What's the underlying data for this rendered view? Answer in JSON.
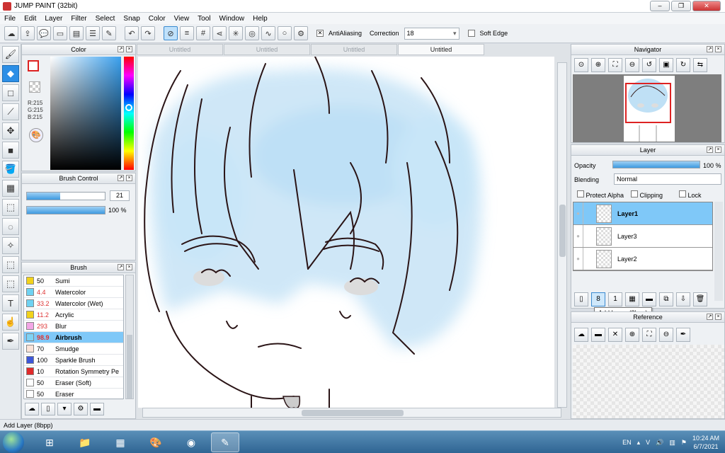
{
  "window": {
    "title": "JUMP PAINT (32bit)"
  },
  "menu": [
    "File",
    "Edit",
    "Layer",
    "Filter",
    "Select",
    "Snap",
    "Color",
    "View",
    "Tool",
    "Window",
    "Help"
  ],
  "toolbar": {
    "antialias_label": "AntiAliasing",
    "correction_label": "Correction",
    "correction_value": "18",
    "softedge_label": "Soft Edge"
  },
  "color_panel": {
    "title": "Color",
    "r": "R:215",
    "g": "G:215",
    "b": "B:215"
  },
  "brush_control": {
    "title": "Brush Control",
    "size": "21",
    "opacity": "100 %",
    "size_fraction": 0.43,
    "opacity_fraction": 1.0
  },
  "brush_panel": {
    "title": "Brush",
    "items": [
      {
        "size": "50",
        "name": "Sumi",
        "color": "#f2d21b"
      },
      {
        "size": "4.4",
        "name": "Watercolor",
        "color": "#6fd2f2"
      },
      {
        "size": "33.2",
        "name": "Watercolor (Wet)",
        "color": "#6fd2f2"
      },
      {
        "size": "11.2",
        "name": "Acrylic",
        "color": "#f2d21b"
      },
      {
        "size": "293",
        "name": "Blur",
        "color": "#f3a6e6"
      },
      {
        "size": "98.9",
        "name": "Airbrush",
        "color": "#7fd3f5"
      },
      {
        "size": "70",
        "name": "Smudge",
        "color": "#fbe3d8"
      },
      {
        "size": "100",
        "name": "Sparkle Brush",
        "color": "#3d57d8"
      },
      {
        "size": "10",
        "name": "Rotation Symmetry Pe",
        "color": "#e02a2a"
      },
      {
        "size": "50",
        "name": "Eraser (Soft)",
        "color": "#ffffff"
      },
      {
        "size": "50",
        "name": "Eraser",
        "color": "#ffffff"
      }
    ]
  },
  "tabs": [
    "Untitled",
    "Untitled",
    "Untitled",
    "Untitled"
  ],
  "navigator": {
    "title": "Navigator"
  },
  "layer_panel": {
    "title": "Layer",
    "opacity_label": "Opacity",
    "opacity_value": "100 %",
    "blending_label": "Blending",
    "blending_value": "Normal",
    "protect_alpha": "Protect Alpha",
    "clipping": "Clipping",
    "lock": "Lock",
    "layers": [
      "Layer1",
      "Layer3",
      "Layer2"
    ]
  },
  "tooltip": "Add Layer (8bpp)",
  "reference_panel": {
    "title": "Reference"
  },
  "status": "Add Layer (8bpp)",
  "taskbar": {
    "lang": "EN",
    "time": "10:24 AM",
    "date": "6/7/2021"
  }
}
